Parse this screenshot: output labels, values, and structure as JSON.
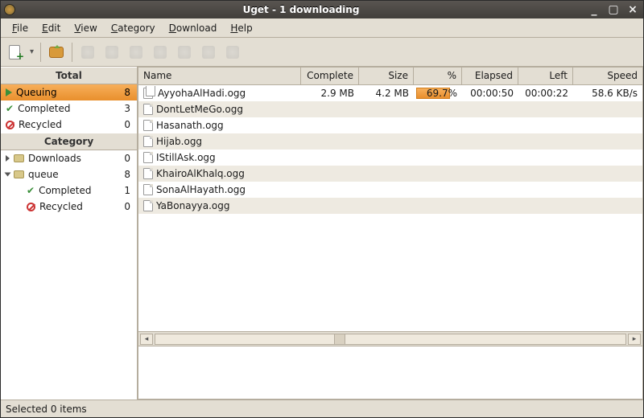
{
  "title": "Uget - 1 downloading",
  "menu": {
    "file": "File",
    "edit": "Edit",
    "view": "View",
    "category": "Category",
    "download": "Download",
    "help": "Help"
  },
  "sidebar": {
    "total_header": "Total",
    "category_header": "Category",
    "total": [
      {
        "icon": "play",
        "label": "Queuing",
        "count": 8,
        "selected": true
      },
      {
        "icon": "check",
        "label": "Completed",
        "count": 3
      },
      {
        "icon": "recycled",
        "label": "Recycled",
        "count": 0
      }
    ],
    "categories": [
      {
        "expandable": true,
        "open": false,
        "icon": "folder",
        "label": "Downloads",
        "count": 0
      },
      {
        "expandable": true,
        "open": true,
        "icon": "folder",
        "label": "queue",
        "count": 8,
        "children": [
          {
            "icon": "check",
            "label": "Completed",
            "count": 1
          },
          {
            "icon": "recycled",
            "label": "Recycled",
            "count": 0
          }
        ]
      }
    ]
  },
  "columns": {
    "name": "Name",
    "complete": "Complete",
    "size": "Size",
    "percent": "%",
    "elapsed": "Elapsed",
    "left": "Left",
    "speed": "Speed"
  },
  "downloads": [
    {
      "icon": "dl",
      "name": "AyyohaAlHadi.ogg",
      "complete": "2.9 MB",
      "size": "4.2 MB",
      "percent": 69.7,
      "percent_label": "69.7%",
      "elapsed": "00:00:50",
      "left": "00:00:22",
      "speed": "58.6 KB/s"
    },
    {
      "icon": "file",
      "name": "DontLetMeGo.ogg"
    },
    {
      "icon": "file",
      "name": "Hasanath.ogg"
    },
    {
      "icon": "file",
      "name": "Hijab.ogg"
    },
    {
      "icon": "file",
      "name": "IStillAsk.ogg"
    },
    {
      "icon": "file",
      "name": "KhairoAlKhalq.ogg"
    },
    {
      "icon": "file",
      "name": "SonaAlHayath.ogg"
    },
    {
      "icon": "file",
      "name": "YaBonayya.ogg"
    }
  ],
  "statusbar": "Selected 0 items"
}
